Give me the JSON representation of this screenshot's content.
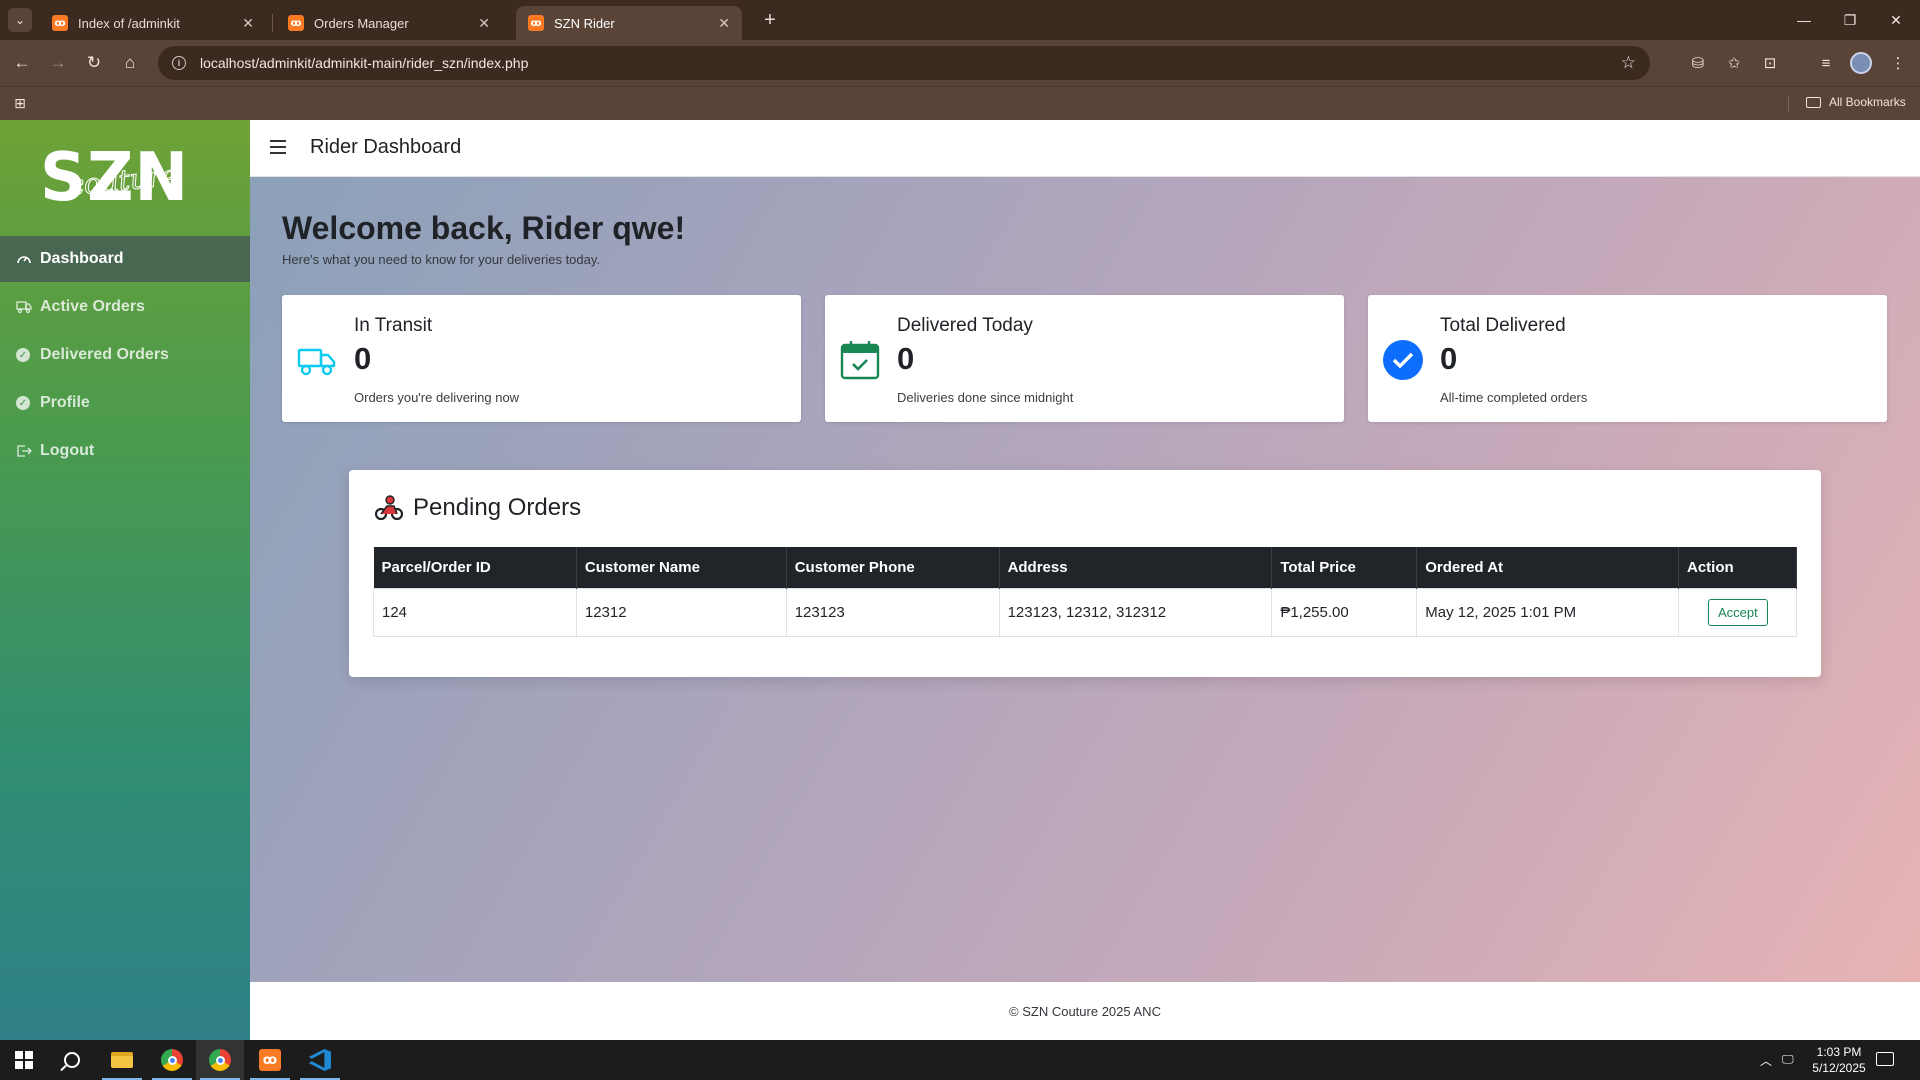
{
  "browser": {
    "tabs": [
      {
        "title": "Index of /adminkit",
        "active": false
      },
      {
        "title": "Orders Manager",
        "active": false
      },
      {
        "title": "SZN Rider",
        "active": true
      }
    ],
    "url": "localhost/adminkit/adminkit-main/rider_szn/index.php",
    "bookmarks_label": "All Bookmarks"
  },
  "sidebar": {
    "logo_text": "SZN",
    "logo_script": "couture",
    "items": [
      {
        "label": "Dashboard",
        "icon": "gauge-icon",
        "active": true
      },
      {
        "label": "Active Orders",
        "icon": "truck-icon",
        "active": false
      },
      {
        "label": "Delivered Orders",
        "icon": "check-circle-icon",
        "active": false
      },
      {
        "label": "Profile",
        "icon": "check-circle-icon",
        "active": false
      },
      {
        "label": "Logout",
        "icon": "logout-icon",
        "active": false
      }
    ]
  },
  "header": {
    "title": "Rider Dashboard"
  },
  "welcome": {
    "title": "Welcome back, Rider qwe!",
    "subtitle": "Here's what you need to know for your deliveries today."
  },
  "stats": [
    {
      "label": "In Transit",
      "value": "0",
      "desc": "Orders you're delivering now",
      "icon": "truck-icon",
      "color": "#0dcaf0"
    },
    {
      "label": "Delivered Today",
      "value": "0",
      "desc": "Deliveries done since midnight",
      "icon": "calendar-check-icon",
      "color": "#198754"
    },
    {
      "label": "Total Delivered",
      "value": "0",
      "desc": "All-time completed orders",
      "icon": "check-circle-icon",
      "color": "#0d6efd"
    }
  ],
  "pending": {
    "title": "Pending Orders",
    "icon": "motorcycle-icon",
    "columns": [
      "Parcel/Order ID",
      "Customer Name",
      "Customer Phone",
      "Address",
      "Total Price",
      "Ordered At",
      "Action"
    ],
    "rows": [
      {
        "id": "124",
        "name": "12312",
        "phone": "123123",
        "address": "123123, 12312, 312312",
        "price": "₱1,255.00",
        "ordered_at": "May 12, 2025 1:01 PM",
        "action": "Accept"
      }
    ]
  },
  "footer": {
    "text": "© SZN Couture 2025 ANC"
  },
  "taskbar": {
    "time": "1:03 PM",
    "date": "5/12/2025"
  },
  "colors": {
    "accent": "#198754",
    "sidebar_top": "#6ea236",
    "sidebar_bottom": "#2e7f86"
  }
}
